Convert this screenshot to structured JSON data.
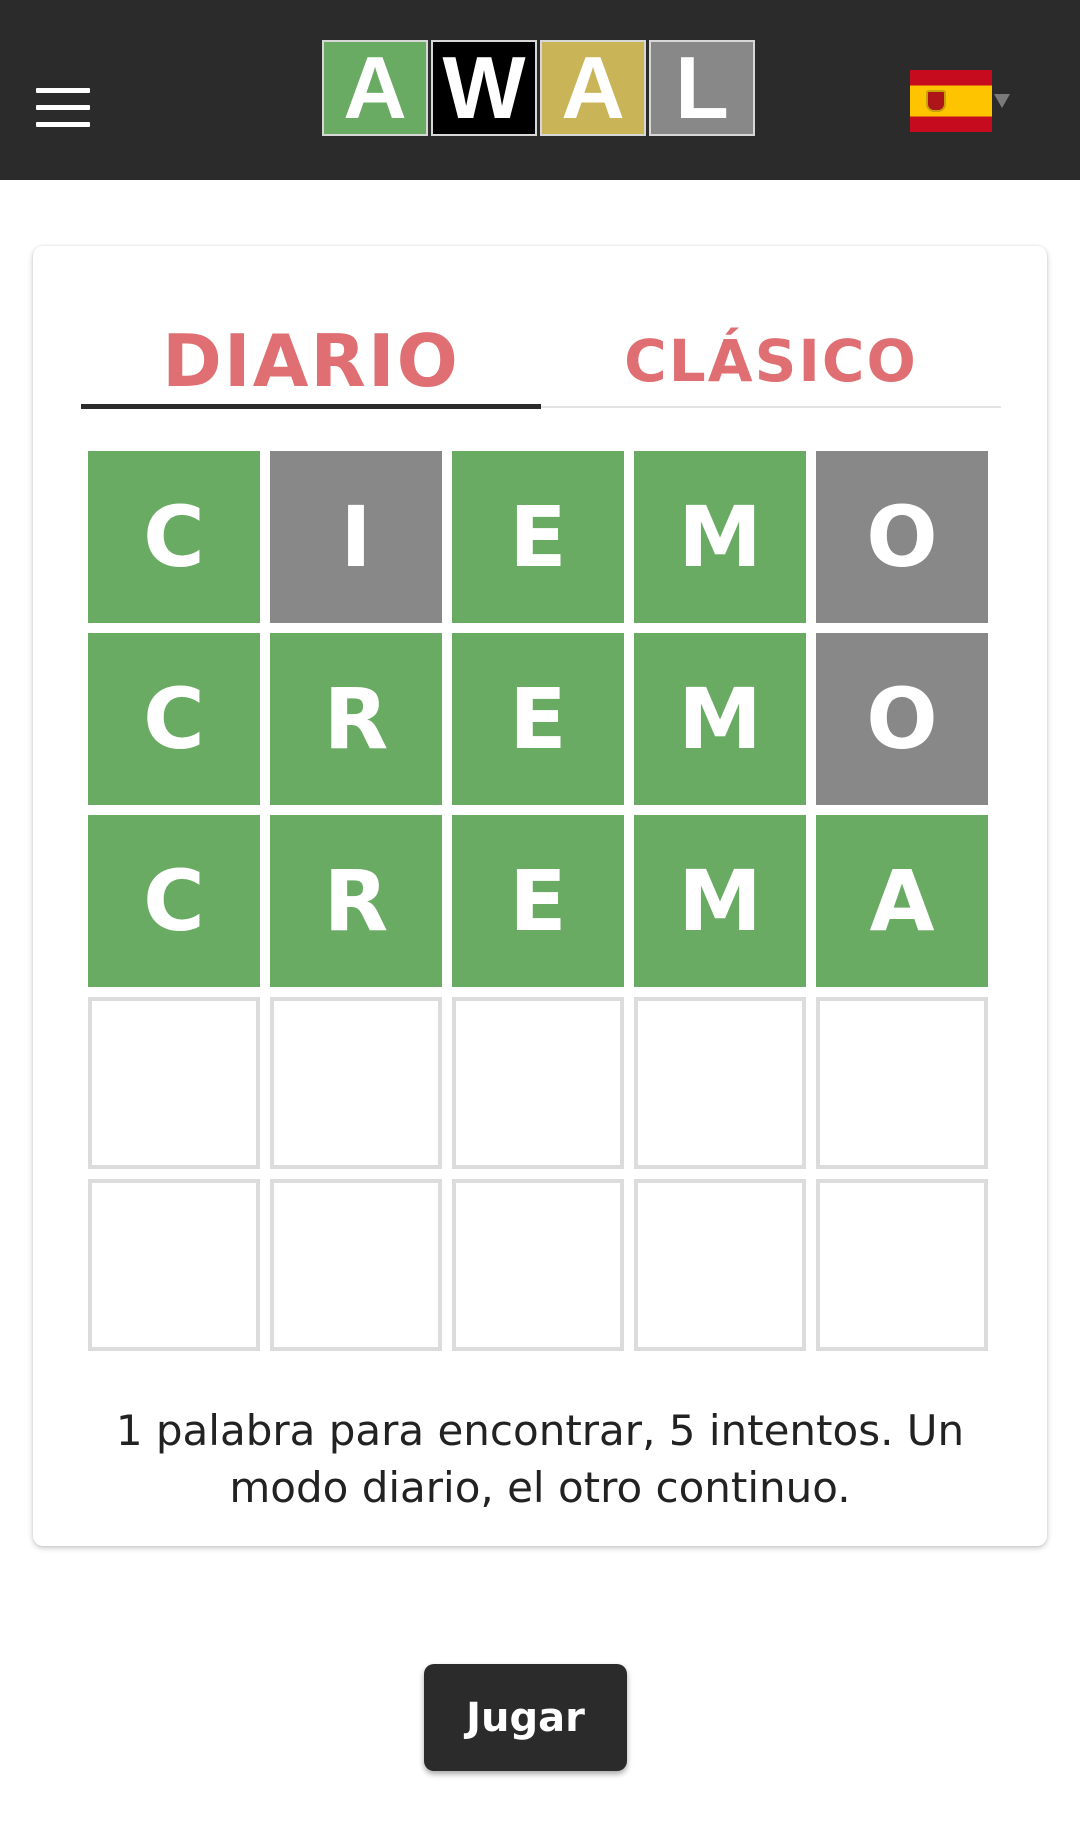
{
  "header": {
    "menu_icon": "hamburger-menu-icon",
    "logo": {
      "tiles": [
        {
          "letter": "A",
          "color": "#6aab64"
        },
        {
          "letter": "W",
          "color": "#000000"
        },
        {
          "letter": "A",
          "color": "#c9b458"
        },
        {
          "letter": "L",
          "color": "#888888"
        }
      ]
    },
    "language": {
      "flag_icon": "spain-flag-icon",
      "caret_icon": "chevron-down-icon"
    }
  },
  "tabs": [
    {
      "label": "DIARIO",
      "active": true
    },
    {
      "label": "CLÁSICO",
      "active": false
    }
  ],
  "board": {
    "rows": [
      [
        {
          "letter": "C",
          "state": "correct"
        },
        {
          "letter": "I",
          "state": "absent"
        },
        {
          "letter": "E",
          "state": "correct"
        },
        {
          "letter": "M",
          "state": "correct"
        },
        {
          "letter": "O",
          "state": "absent"
        }
      ],
      [
        {
          "letter": "C",
          "state": "correct"
        },
        {
          "letter": "R",
          "state": "correct"
        },
        {
          "letter": "E",
          "state": "correct"
        },
        {
          "letter": "M",
          "state": "correct"
        },
        {
          "letter": "O",
          "state": "absent"
        }
      ],
      [
        {
          "letter": "C",
          "state": "correct"
        },
        {
          "letter": "R",
          "state": "correct"
        },
        {
          "letter": "E",
          "state": "correct"
        },
        {
          "letter": "M",
          "state": "correct"
        },
        {
          "letter": "A",
          "state": "correct"
        }
      ],
      [
        {
          "letter": "",
          "state": "empty"
        },
        {
          "letter": "",
          "state": "empty"
        },
        {
          "letter": "",
          "state": "empty"
        },
        {
          "letter": "",
          "state": "empty"
        },
        {
          "letter": "",
          "state": "empty"
        }
      ],
      [
        {
          "letter": "",
          "state": "empty"
        },
        {
          "letter": "",
          "state": "empty"
        },
        {
          "letter": "",
          "state": "empty"
        },
        {
          "letter": "",
          "state": "empty"
        },
        {
          "letter": "",
          "state": "empty"
        }
      ]
    ]
  },
  "description": "1 palabra para encontrar, 5 intentos. Un modo diario, el otro continuo.",
  "play_button": "Jugar",
  "colors": {
    "correct": "#6aab64",
    "absent": "#888888",
    "present": "#c9b458",
    "header_bg": "#2b2b2b",
    "tab_text": "#df6f72"
  }
}
